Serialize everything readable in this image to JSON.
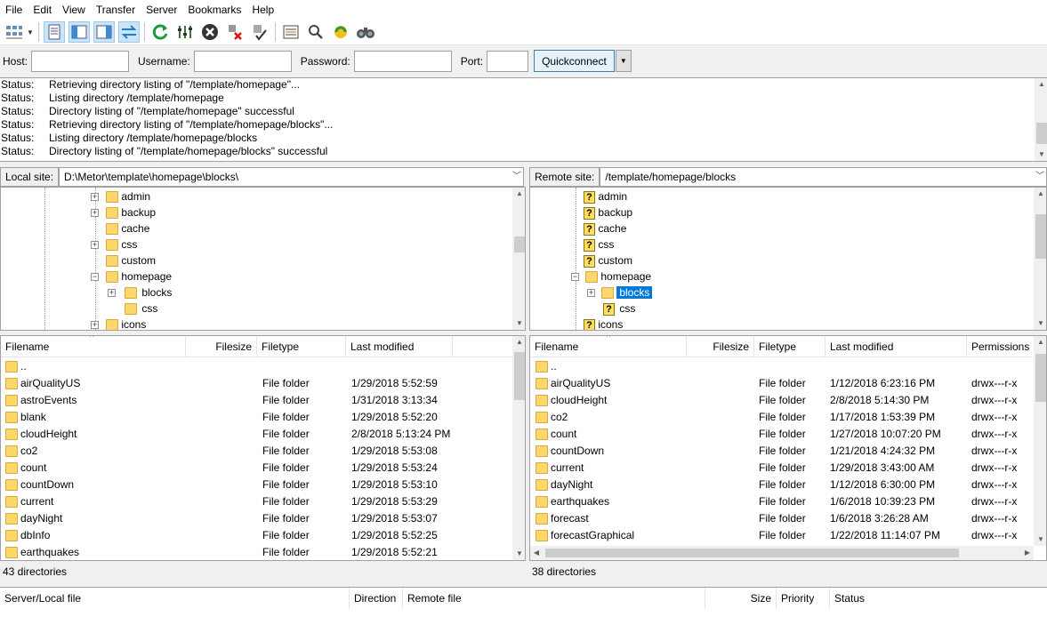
{
  "menu": [
    "File",
    "Edit",
    "View",
    "Transfer",
    "Server",
    "Bookmarks",
    "Help"
  ],
  "toolbar_icons": [
    "site-manager-icon",
    "site-manager-dropdown-icon",
    "toggle-log-icon",
    "toggle-local-tree-icon",
    "toggle-remote-tree-icon",
    "toggle-queue-icon",
    "refresh-icon",
    "process-queue-icon",
    "cancel-icon",
    "disconnect-icon",
    "reconnect-icon",
    "directory-filter-icon",
    "sync-browsing-icon",
    "compare-icon",
    "search-icon"
  ],
  "quickconnect": {
    "host_label": "Host:",
    "username_label": "Username:",
    "password_label": "Password:",
    "port_label": "Port:",
    "host_value": "",
    "username_value": "",
    "password_value": "",
    "port_value": "",
    "button": "Quickconnect"
  },
  "log": [
    {
      "type": "Status:",
      "msg": "Retrieving directory listing of \"/template/homepage\"..."
    },
    {
      "type": "Status:",
      "msg": "Listing directory /template/homepage"
    },
    {
      "type": "Status:",
      "msg": "Directory listing of \"/template/homepage\" successful"
    },
    {
      "type": "Status:",
      "msg": "Retrieving directory listing of \"/template/homepage/blocks\"..."
    },
    {
      "type": "Status:",
      "msg": "Listing directory /template/homepage/blocks"
    },
    {
      "type": "Status:",
      "msg": "Directory listing of \"/template/homepage/blocks\" successful"
    }
  ],
  "local": {
    "site_label": "Local site:",
    "path": "D:\\Metor\\template\\homepage\\blocks\\",
    "tree": [
      "admin",
      "backup",
      "cache",
      "css",
      "custom",
      "homepage",
      "blocks",
      "css",
      "icons"
    ],
    "headers": {
      "filename": "Filename",
      "filesize": "Filesize",
      "filetype": "Filetype",
      "modified": "Last modified"
    },
    "files": [
      {
        "name": "..",
        "type": "",
        "modified": ""
      },
      {
        "name": "airQualityUS",
        "type": "File folder",
        "modified": "1/29/2018 5:52:59"
      },
      {
        "name": "astroEvents",
        "type": "File folder",
        "modified": "1/31/2018 3:13:34"
      },
      {
        "name": "blank",
        "type": "File folder",
        "modified": "1/29/2018 5:52:20"
      },
      {
        "name": "cloudHeight",
        "type": "File folder",
        "modified": "2/8/2018 5:13:24 PM"
      },
      {
        "name": "co2",
        "type": "File folder",
        "modified": "1/29/2018 5:53:08"
      },
      {
        "name": "count",
        "type": "File folder",
        "modified": "1/29/2018 5:53:24"
      },
      {
        "name": "countDown",
        "type": "File folder",
        "modified": "1/29/2018 5:53:10"
      },
      {
        "name": "current",
        "type": "File folder",
        "modified": "1/29/2018 5:53:29"
      },
      {
        "name": "dayNight",
        "type": "File folder",
        "modified": "1/29/2018 5:53:07"
      },
      {
        "name": "dbInfo",
        "type": "File folder",
        "modified": "1/29/2018 5:52:25"
      },
      {
        "name": "earthquakes",
        "type": "File folder",
        "modified": "1/29/2018 5:52:21"
      }
    ],
    "status": "43 directories"
  },
  "remote": {
    "site_label": "Remote site:",
    "path": "/template/homepage/blocks",
    "tree": [
      "admin",
      "backup",
      "cache",
      "css",
      "custom",
      "homepage",
      "blocks",
      "css",
      "icons"
    ],
    "headers": {
      "filename": "Filename",
      "filesize": "Filesize",
      "filetype": "Filetype",
      "modified": "Last modified",
      "permissions": "Permissions"
    },
    "files": [
      {
        "name": "..",
        "type": "",
        "modified": "",
        "perm": ""
      },
      {
        "name": "airQualityUS",
        "type": "File folder",
        "modified": "1/12/2018 6:23:16 PM",
        "perm": "drwx---r-x"
      },
      {
        "name": "cloudHeight",
        "type": "File folder",
        "modified": "2/8/2018 5:14:30 PM",
        "perm": "drwx---r-x"
      },
      {
        "name": "co2",
        "type": "File folder",
        "modified": "1/17/2018 1:53:39 PM",
        "perm": "drwx---r-x"
      },
      {
        "name": "count",
        "type": "File folder",
        "modified": "1/27/2018 10:07:20 PM",
        "perm": "drwx---r-x"
      },
      {
        "name": "countDown",
        "type": "File folder",
        "modified": "1/21/2018 4:24:32 PM",
        "perm": "drwx---r-x"
      },
      {
        "name": "current",
        "type": "File folder",
        "modified": "1/29/2018 3:43:00 AM",
        "perm": "drwx---r-x"
      },
      {
        "name": "dayNight",
        "type": "File folder",
        "modified": "1/12/2018 6:30:00 PM",
        "perm": "drwx---r-x"
      },
      {
        "name": "earthquakes",
        "type": "File folder",
        "modified": "1/6/2018 10:39:23 PM",
        "perm": "drwx---r-x"
      },
      {
        "name": "forecast",
        "type": "File folder",
        "modified": "1/6/2018 3:26:28 AM",
        "perm": "drwx---r-x"
      },
      {
        "name": "forecastGraphical",
        "type": "File folder",
        "modified": "1/22/2018 11:14:07 PM",
        "perm": "drwx---r-x"
      }
    ],
    "status": "38 directories"
  },
  "queue": {
    "server_local_file": "Server/Local file",
    "direction": "Direction",
    "remote_file": "Remote file",
    "size": "Size",
    "priority": "Priority",
    "status": "Status"
  }
}
